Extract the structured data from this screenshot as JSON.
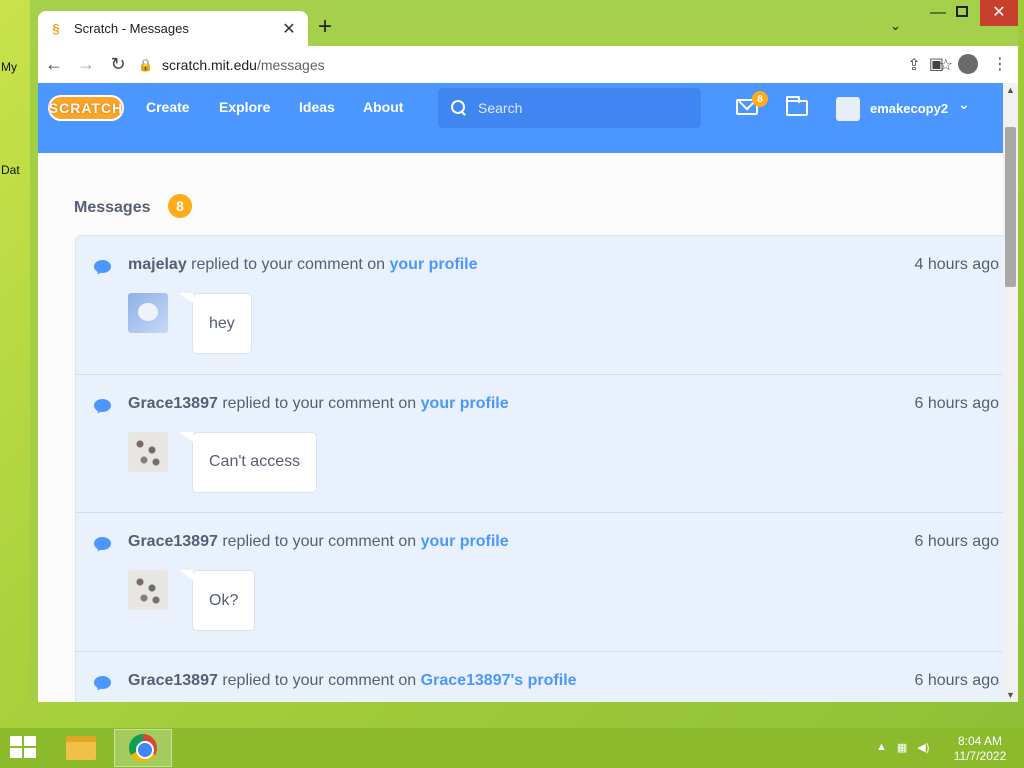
{
  "desktop": {
    "icon_labels": [
      "My",
      "Dat"
    ]
  },
  "browser": {
    "tab": {
      "title": "Scratch - Messages",
      "favicon": "scratch-cat-icon"
    },
    "url": {
      "domain": "scratch.mit.edu",
      "path": "/messages"
    }
  },
  "scratch": {
    "nav": {
      "logo": "SCRATCH",
      "links": [
        "Create",
        "Explore",
        "Ideas",
        "About"
      ],
      "search_placeholder": "Search",
      "messages_badge": "8",
      "username": "emakecopy2"
    },
    "messages": {
      "title": "Messages",
      "count": "8",
      "connector": "replied to your comment on",
      "items": [
        {
          "user": "majelay",
          "target": "your profile",
          "time": "4 hours ago",
          "comment": "hey",
          "avatar": "cat"
        },
        {
          "user": "Grace13897",
          "target": "your profile",
          "time": "6 hours ago",
          "comment": "Can't access",
          "avatar": "dots"
        },
        {
          "user": "Grace13897",
          "target": "your profile",
          "time": "6 hours ago",
          "comment": "Ok?",
          "avatar": "dots"
        },
        {
          "user": "Grace13897",
          "target": "Grace13897's profile",
          "time": "6 hours ago",
          "comment": "",
          "avatar": "dots"
        }
      ]
    }
  },
  "taskbar": {
    "time": "8:04 AM",
    "date": "11/7/2022"
  },
  "colors": {
    "scratch_blue": "#4c97ff",
    "badge_orange": "#ffab1a",
    "message_bg": "#e9f1fc"
  }
}
